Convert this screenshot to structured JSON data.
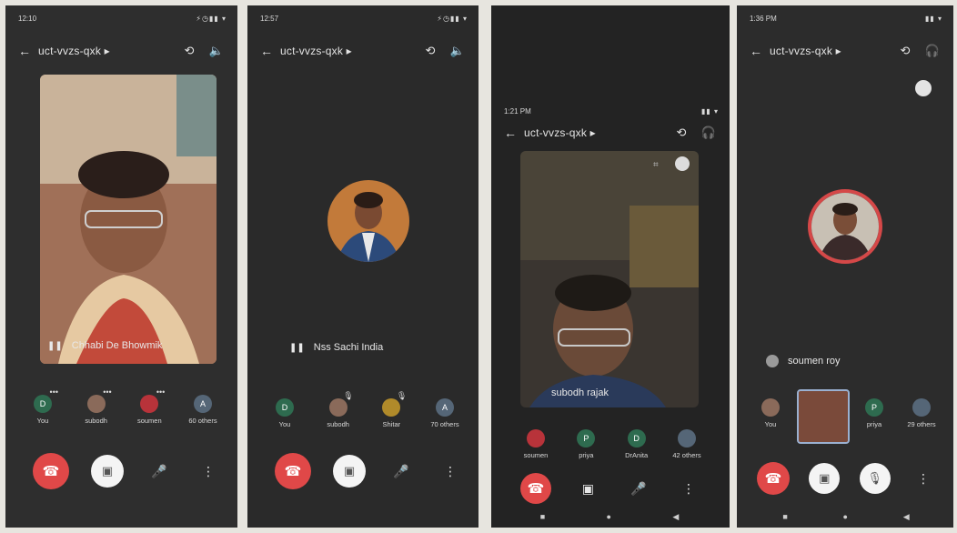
{
  "meeting_code": "uct-vvzs-qxk",
  "icons": {
    "back": "←",
    "chevron": "▸",
    "switch_camera": "⟲",
    "speaker": "🔈",
    "headset": "🎧",
    "mic_off": "🎙",
    "end_call": "☎",
    "video_off": "▣",
    "mic": "🎤",
    "more": "⋮",
    "dots": "•••",
    "audio_level": "❚❚"
  },
  "panels": [
    {
      "status_time": "12:10",
      "status_right": "⚡◷▮▮ ▾",
      "main_name": "Chhabi De Bhowmik",
      "participants": [
        {
          "label": "You",
          "initial": "D",
          "color": "#2e6b4f"
        },
        {
          "label": "subodh",
          "initial": "",
          "color": "#8a6a5a"
        },
        {
          "label": "soumen",
          "initial": "",
          "color": "#b8333a"
        },
        {
          "label": "60 others",
          "initial": "A",
          "color": "#556677"
        }
      ]
    },
    {
      "status_time": "12:57",
      "status_right": "⚡◷▮▮ ▾",
      "main_name": "Nss Sachi India",
      "participants": [
        {
          "label": "You",
          "initial": "D",
          "color": "#2e6b4f"
        },
        {
          "label": "subodh",
          "initial": "",
          "color": "#8a6a5a"
        },
        {
          "label": "Shitar",
          "initial": "",
          "color": "#b08a2a"
        },
        {
          "label": "70 others",
          "initial": "A",
          "color": "#556677"
        }
      ]
    },
    {
      "status_time": "1:21 PM",
      "status_right": "▮▮ ▾",
      "main_name": "subodh rajak",
      "participants": [
        {
          "label": "soumen",
          "initial": "",
          "color": "#b8333a"
        },
        {
          "label": "priya",
          "initial": "P",
          "color": "#2e6b4f"
        },
        {
          "label": "DrAnita",
          "initial": "D",
          "color": "#2e6b4f"
        },
        {
          "label": "42 others",
          "initial": "",
          "color": "#556677"
        }
      ]
    },
    {
      "status_time": "1:36 PM",
      "status_right": "▮▮ ▾",
      "main_name": "soumen roy",
      "participants": [
        {
          "label": "You",
          "initial": "",
          "color": "#8a6a5a"
        },
        {
          "label": "",
          "initial": "",
          "color": "#7a4a3a"
        },
        {
          "label": "priya",
          "initial": "P",
          "color": "#2e6b4f"
        },
        {
          "label": "29 others",
          "initial": "",
          "color": "#556677"
        }
      ]
    }
  ],
  "nav": {
    "home": "■",
    "circle": "●",
    "back": "◀"
  }
}
